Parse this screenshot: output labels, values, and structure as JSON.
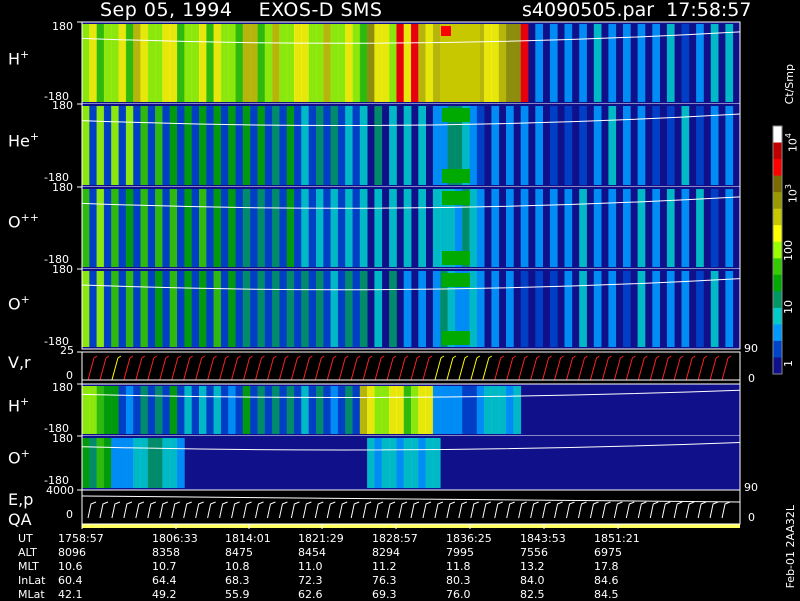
{
  "header": {
    "title": "Sep 05, 1994    EXOS-D SMS",
    "file_time": "s4090505.par  17:58:57"
  },
  "colorbar": {
    "unit": "Ct/Smp",
    "labels": [
      "10^4",
      "10^3",
      "100",
      "10",
      "1"
    ],
    "colors": [
      "#ffffff",
      "#c00000",
      "#ff0000",
      "#7a6a00",
      "#9a9a00",
      "#c8c800",
      "#ffff00",
      "#9aff00",
      "#33cc00",
      "#00aa00",
      "#009966",
      "#00cccc",
      "#0099ff",
      "#0044cc",
      "#10108a"
    ]
  },
  "side_id": "Feb-01 2AA32L",
  "footer": {
    "labels": [
      "UT",
      "ALT",
      "MLT",
      "InLat",
      "MLat"
    ],
    "columns": [
      [
        "1758:57",
        "8096",
        "10.6",
        "60.4",
        "42.1"
      ],
      [
        "1806:33",
        "8358",
        "10.7",
        "64.4",
        "49.2"
      ],
      [
        "1814:01",
        "8475",
        "10.8",
        "68.3",
        "55.9"
      ],
      [
        "1821:29",
        "8454",
        "11.0",
        "72.3",
        "62.6"
      ],
      [
        "1828:57",
        "8294",
        "11.2",
        "76.3",
        "69.3"
      ],
      [
        "1836:25",
        "7995",
        "11.8",
        "80.3",
        "76.0"
      ],
      [
        "1843:53",
        "7556",
        "13.2",
        "84.0",
        "82.5"
      ],
      [
        "1851:21",
        "6975",
        "17.8",
        "84.6",
        "84.5"
      ]
    ]
  },
  "chart_data": [
    {
      "type": "heatmap",
      "panel": "H+",
      "label": "H",
      "sup": "+",
      "yticks": [
        "180",
        "-180"
      ],
      "ylim": [
        -180,
        180
      ]
    },
    {
      "type": "heatmap",
      "panel": "He+",
      "label": "He",
      "sup": "+",
      "yticks": [
        "180",
        "-180"
      ],
      "ylim": [
        -180,
        180
      ]
    },
    {
      "type": "heatmap",
      "panel": "O++",
      "label": "O",
      "sup": "++",
      "yticks": [
        "180",
        "-180"
      ],
      "ylim": [
        -180,
        180
      ]
    },
    {
      "type": "heatmap",
      "panel": "O+",
      "label": "O",
      "sup": "+",
      "yticks": [
        "180",
        "-180"
      ],
      "ylim": [
        -180,
        180
      ]
    },
    {
      "type": "line",
      "panel": "V,r",
      "label": "V,r",
      "yticks": [
        "25",
        "0"
      ],
      "right_ticks": [
        "90",
        "0"
      ]
    },
    {
      "type": "heatmap",
      "panel": "H+ (2)",
      "label": "H",
      "sup": "+",
      "yticks": [
        "180",
        "-180"
      ],
      "ylim": [
        -180,
        180
      ]
    },
    {
      "type": "heatmap",
      "panel": "O+ (2)",
      "label": "O",
      "sup": "+",
      "yticks": [
        "180",
        "-180"
      ],
      "ylim": [
        -180,
        180
      ]
    },
    {
      "type": "line",
      "panel": "E,p QA",
      "label": "E,p",
      "label2": "QA",
      "yticks": [
        "4000",
        "0"
      ],
      "right_ticks": [
        "90",
        "0"
      ]
    }
  ]
}
